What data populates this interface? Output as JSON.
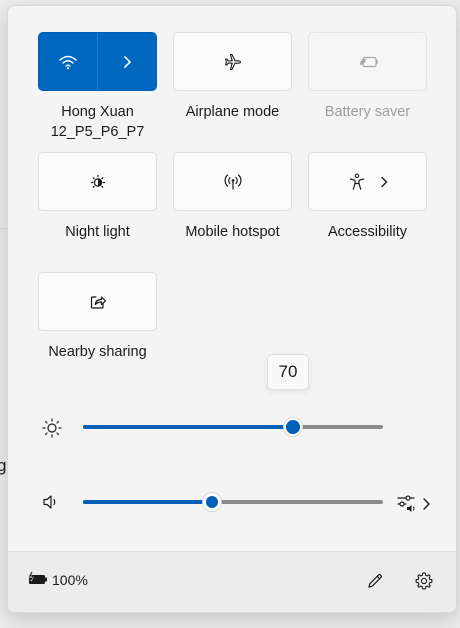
{
  "background": {
    "partial_text": "g"
  },
  "tiles": [
    {
      "id": "wifi",
      "label": "Hong Xuan 12_P5_P6_P7",
      "label_line1": "Hong Xuan",
      "label_line2": "12_P5_P6_P7",
      "state": "on",
      "icon": "wifi-icon",
      "expand": "chevron-right-icon"
    },
    {
      "id": "airplane",
      "label": "Airplane mode",
      "state": "off",
      "icon": "airplane-icon"
    },
    {
      "id": "battery-saver",
      "label": "Battery saver",
      "state": "disabled",
      "icon": "battery-saver-icon"
    },
    {
      "id": "night-light",
      "label": "Night light",
      "state": "off",
      "icon": "night-light-icon"
    },
    {
      "id": "mobile-hotspot",
      "label": "Mobile hotspot",
      "state": "off",
      "icon": "hotspot-icon"
    },
    {
      "id": "accessibility",
      "label": "Accessibility",
      "state": "off",
      "icon": "accessibility-icon",
      "expand": "chevron-right-icon"
    },
    {
      "id": "nearby-sharing",
      "label": "Nearby sharing",
      "state": "off",
      "icon": "share-icon"
    }
  ],
  "brightness": {
    "value": 70,
    "tooltip": "70",
    "icon": "brightness-icon"
  },
  "volume": {
    "value": 43,
    "icon": "speaker-icon",
    "mixer_icon": "volume-mixer-icon"
  },
  "footer": {
    "battery_text": "100%",
    "battery_icon": "battery-charging-icon",
    "edit_icon": "pencil-icon",
    "settings_icon": "gear-icon"
  },
  "colors": {
    "accent": "#0067c0",
    "slider_fill": "#005fb8",
    "panel_bg": "#f4f4f4"
  }
}
